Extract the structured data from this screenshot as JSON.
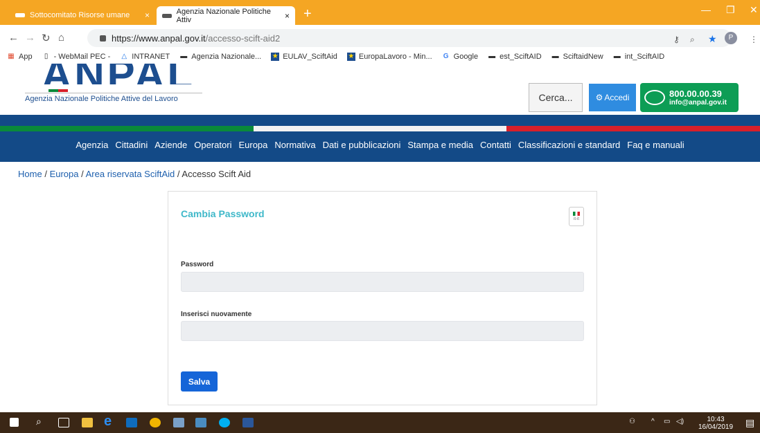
{
  "browser": {
    "tabs": [
      {
        "title": "Sottocomitato Risorse umane",
        "active": false
      },
      {
        "title": "Agenzia Nazionale Politiche Attiv",
        "active": true
      }
    ],
    "new_tab": "+",
    "close_glyph": "×",
    "url_host": "https://www.anpal.gov.it",
    "url_path": "/accesso-scift-aid2",
    "bookmarks": [
      {
        "label": "App",
        "icon": "apps-grid-icon"
      },
      {
        "label": "- WebMail PEC -",
        "icon": "page-icon"
      },
      {
        "label": "INTRANET",
        "icon": "triangle-logo-icon"
      },
      {
        "label": "Agenzia Nazionale...",
        "icon": "site-icon"
      },
      {
        "label": "EULAV_SciftAid",
        "icon": "star-box-icon"
      },
      {
        "label": "EuropaLavoro - Min...",
        "icon": "star-box-icon"
      },
      {
        "label": "Google",
        "icon": "google-icon"
      },
      {
        "label": "est_SciftAID",
        "icon": "site-icon"
      },
      {
        "label": "SciftaidNew",
        "icon": "site-icon"
      },
      {
        "label": "int_SciftAID",
        "icon": "site-icon"
      }
    ],
    "profile_initial": "P"
  },
  "header": {
    "logo_text": "ANPAL",
    "logo_subtitle": "Agenzia Nazionale Politiche Attive del Lavoro",
    "search_label": "Cerca...",
    "login_label": "Accedi",
    "phone": "800.00.00.39",
    "email": "info@anpal.gov.it"
  },
  "nav": {
    "items": [
      "Agenzia",
      "Cittadini",
      "Aziende",
      "Operatori",
      "Europa",
      "Normativa",
      "Dati e pubblicazioni",
      "Stampa e media",
      "Contatti",
      "Classificazioni e standard",
      "Faq e manuali"
    ]
  },
  "breadcrumb": {
    "home": "Home",
    "europa": "Europa",
    "area": "Area riservata SciftAid",
    "current": "Accesso Scift Aid",
    "sep": "/"
  },
  "form": {
    "title": "Cambia Password",
    "lang_code": "it-it",
    "password_label": "Password",
    "confirm_label": "Inserisci nuovamente",
    "save_label": "Salva"
  },
  "taskbar": {
    "time": "10:43",
    "date": "16/04/2019"
  },
  "colors": {
    "nav_blue": "#134a87",
    "accent_green": "#0d9d55",
    "accent_blue": "#2f8ce0",
    "title_cyan": "#3fb8c9",
    "button_blue": "#1565d8"
  }
}
